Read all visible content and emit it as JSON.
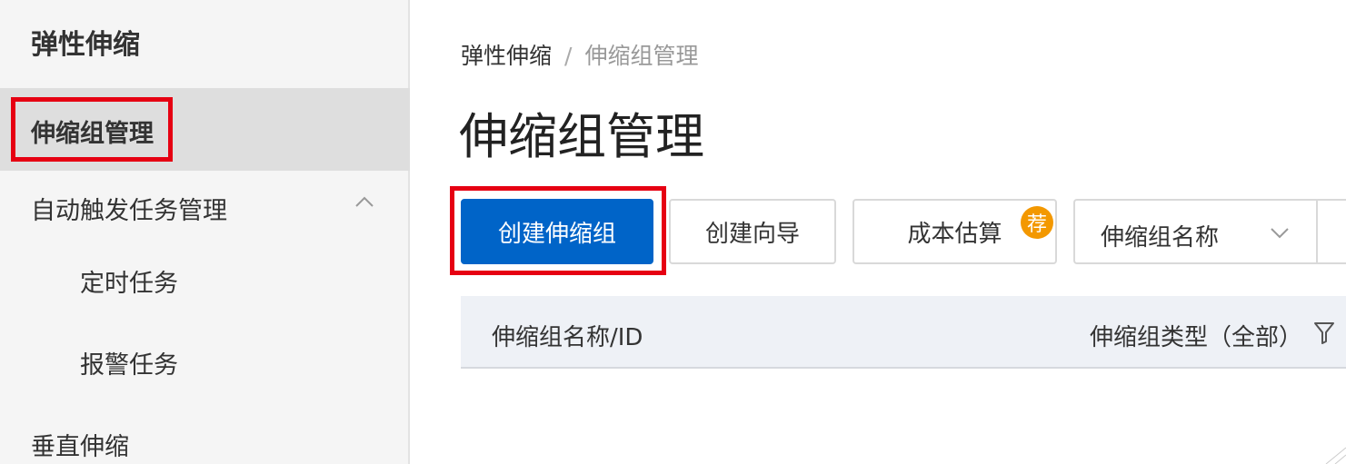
{
  "sidebar": {
    "title": "弹性伸缩",
    "items": [
      {
        "label": "伸缩组管理"
      },
      {
        "label": "自动触发任务管理"
      },
      {
        "label": "定时任务"
      },
      {
        "label": "报警任务"
      },
      {
        "label": "垂直伸缩"
      }
    ]
  },
  "breadcrumb": {
    "root": "弹性伸缩",
    "separator": "/",
    "current": "伸缩组管理"
  },
  "page": {
    "title": "伸缩组管理"
  },
  "toolbar": {
    "create_label": "创建伸缩组",
    "wizard_label": "创建向导",
    "cost_label": "成本估算",
    "cost_badge": "荐",
    "filter_select_value": "伸缩组名称"
  },
  "table": {
    "columns": [
      "伸缩组名称/ID",
      "伸缩组类型（全部）"
    ]
  },
  "colors": {
    "primary": "#0064c8",
    "highlight": "#e60012",
    "badge": "#f39800",
    "sidebar_bg": "#f5f5f5",
    "active_item_bg": "#dedede",
    "table_header_bg": "#eef1f6"
  },
  "icons": [
    "chevron-up-icon",
    "chevron-down-icon",
    "filter-icon",
    "recommend-badge-icon"
  ]
}
